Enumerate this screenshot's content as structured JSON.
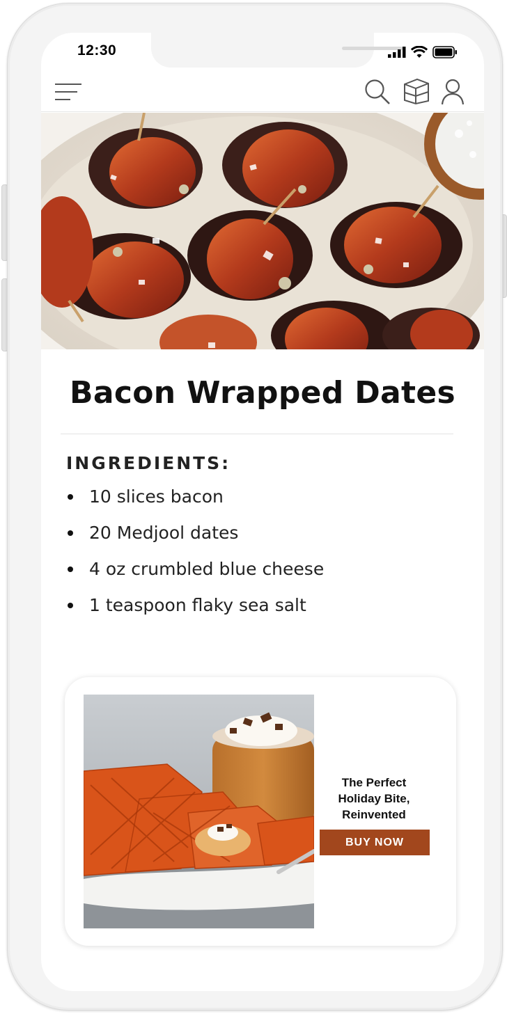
{
  "status_bar": {
    "time": "12:30"
  },
  "nav": {
    "menu_icon": "hamburger-menu-icon",
    "search_icon": "search-icon",
    "box_icon": "package-icon",
    "user_icon": "user-icon"
  },
  "recipe": {
    "title": "Bacon Wrapped Dates",
    "ingredients_heading": "INGREDIENTS:",
    "ingredients": [
      "10 slices bacon",
      "20 Medjool dates",
      "4 oz crumbled blue cheese",
      "1 teaspoon flaky sea salt"
    ]
  },
  "ad": {
    "headline_lines": [
      "The Perfect",
      "Holiday Bite,",
      "Reinvented"
    ],
    "button_label": "BUY NOW",
    "button_color": "#a2471d"
  }
}
